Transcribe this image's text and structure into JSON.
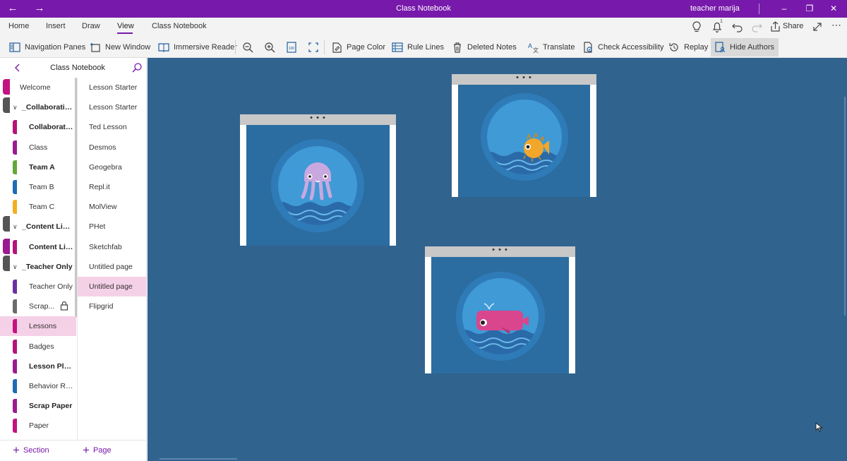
{
  "window": {
    "title": "Class Notebook",
    "user": "teacher marija",
    "accent": "#7719aa"
  },
  "menu": {
    "tabs": [
      {
        "label": "Home"
      },
      {
        "label": "Insert"
      },
      {
        "label": "Draw"
      },
      {
        "label": "View"
      },
      {
        "label": "Class Notebook"
      }
    ],
    "active_tab": "View",
    "share_label": "Share",
    "notification_count": "1"
  },
  "ribbon": {
    "navigation_panes": "Navigation Panes",
    "new_window": "New Window",
    "immersive_reader": "Immersive Reader",
    "page_color": "Page Color",
    "rule_lines": "Rule Lines",
    "deleted_notes": "Deleted Notes",
    "translate": "Translate",
    "check_accessibility": "Check Accessibility",
    "replay": "Replay",
    "hide_authors": "Hide Authors"
  },
  "nav": {
    "notebook_title": "Class Notebook",
    "sections": [
      {
        "label": "Welcome",
        "kind": "welcome",
        "color": ""
      },
      {
        "label": "_Collaboration Space",
        "kind": "group",
        "color": ""
      },
      {
        "label": "Collaboration Space",
        "kind": "bold",
        "color": "#b5137a"
      },
      {
        "label": "Class",
        "kind": "normal",
        "color": "#9b1a8f"
      },
      {
        "label": "Team A",
        "kind": "bold",
        "color": "#62a837"
      },
      {
        "label": "Team B",
        "kind": "normal",
        "color": "#1f6bb5"
      },
      {
        "label": "Team C",
        "kind": "normal",
        "color": "#f2b01e"
      },
      {
        "label": "_Content Library",
        "kind": "group",
        "color": ""
      },
      {
        "label": "Content Library",
        "kind": "bold",
        "color": "#b5137a"
      },
      {
        "label": "_Teacher Only",
        "kind": "group",
        "color": ""
      },
      {
        "label": "Teacher Only",
        "kind": "normal",
        "color": "#6b2fa0"
      },
      {
        "label": "Scrap...",
        "kind": "locked",
        "color": "#6b6b6b"
      },
      {
        "label": "Lessons",
        "kind": "selected",
        "color": "#c4127f"
      },
      {
        "label": "Badges",
        "kind": "normal",
        "color": "#b5137a"
      },
      {
        "label": "Lesson Plans",
        "kind": "bold",
        "color": "#9b1a8f"
      },
      {
        "label": "Behavior Records",
        "kind": "normal",
        "color": "#1f6bb5"
      },
      {
        "label": "Scrap Paper",
        "kind": "bold",
        "color": "#9b1a8f"
      },
      {
        "label": "Paper",
        "kind": "normal",
        "color": "#c4127f"
      }
    ],
    "pages": [
      {
        "label": "Lesson Starter"
      },
      {
        "label": "Lesson Starter"
      },
      {
        "label": "Ted Lesson"
      },
      {
        "label": "Desmos"
      },
      {
        "label": "Geogebra"
      },
      {
        "label": "Repl.it"
      },
      {
        "label": "MolView"
      },
      {
        "label": "PHet"
      },
      {
        "label": "Sketchfab"
      },
      {
        "label": "Untitled page"
      },
      {
        "label": "Untitled page",
        "selected": true
      },
      {
        "label": "Flipgrid"
      }
    ],
    "add_section": "Section",
    "add_page": "Page"
  },
  "canvas": {
    "background": "#31638f",
    "cards": [
      {
        "name": "jellyfish-card",
        "handle": "• • •",
        "animal": "jellyfish-icon"
      },
      {
        "name": "pufferfish-card",
        "handle": "• • •",
        "animal": "pufferfish-icon"
      },
      {
        "name": "whale-card",
        "handle": "• • •",
        "animal": "whale-icon"
      }
    ]
  }
}
